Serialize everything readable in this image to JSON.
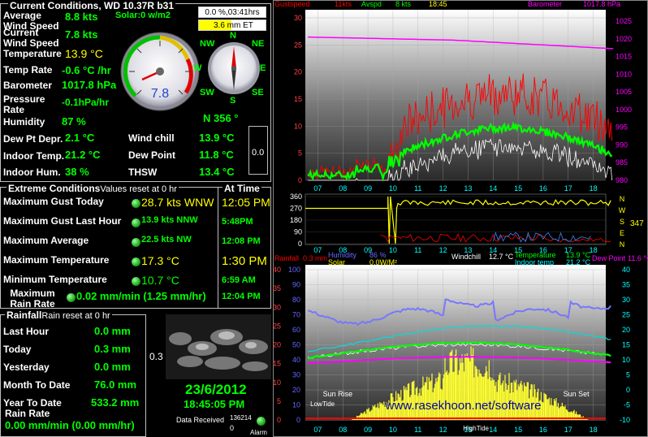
{
  "current": {
    "title": "Current Conditions, WD 10.37R b31",
    "avg_wind_label": "Average Wind Speed",
    "avg_wind_value": "8.8 kts",
    "solar": "Solar:0 w/m2",
    "cur_wind_label": "Current Wind Speed",
    "cur_wind_value": "7.8 kts",
    "temp_label": "Temperature",
    "temp_value": "13.9 °C",
    "temprate_label": "Temp Rate",
    "temprate_value": "-0.6 °C /hr",
    "baro_label": "Barometer",
    "baro_value": "1017.8 hPa",
    "prate_label": "Pressure Rate",
    "prate_value": "-0.1hPa/hr",
    "hum_label": "Humidity",
    "hum_value": "87 %",
    "dir_value": "N  356 °",
    "dew_label": "Dew Pt Depr.",
    "dew_value": "2.1 °C",
    "chill_label": "Wind chill",
    "chill_value": "13.9 °C",
    "itemp_label": "Indoor Temp.",
    "itemp_value": "21.2 °C",
    "dewpt_label": "Dew Point",
    "dewpt_value": "11.8 °C",
    "ihum_label": "Indoor Hum.",
    "ihum_value": "38 %",
    "thsw_label": "THSW",
    "thsw_value": "13.4 °C",
    "box_value": "0.0",
    "rain_pct": "0.0 %,03:41hrs",
    "et": "3.6 mm ET",
    "gauge_speed": "7.8"
  },
  "extremes": {
    "title": "Extreme Conditions",
    "reset": "Values reset at 0 hr",
    "at_time": "At Time",
    "rows": [
      {
        "label": "Maximum Gust Today",
        "value": "28.7 kts WNW",
        "time": "12:05 PM"
      },
      {
        "label": "Maximum Gust Last Hour",
        "value": "13.9 kts NNW",
        "time": "5:48PM"
      },
      {
        "label": "Maximum Average",
        "value": "22.5 kts  NW",
        "time": "12:08 PM"
      },
      {
        "label": "Maximum Temperature",
        "value": "17.3 °C",
        "time": "1:30 PM"
      },
      {
        "label": "Minimum Temperature",
        "value": "10.7 °C",
        "time": "6:59 AM"
      },
      {
        "label": "Maximum Rain Rate",
        "value": "0.02 mm/min (1.25 mm/hr)",
        "time": "12:04 PM"
      }
    ]
  },
  "rainfall": {
    "title": "Rainfall",
    "reset": "Rain reset at 0 hr",
    "rows": [
      {
        "label": "Last Hour",
        "value": "0.0 mm"
      },
      {
        "label": "Today",
        "value": "0.3 mm"
      },
      {
        "label": "Yesterday",
        "value": "0.0 mm"
      },
      {
        "label": "Month To Date",
        "value": "76.0 mm"
      },
      {
        "label": "Year To Date",
        "value": "533.2 mm"
      }
    ],
    "rate_label": "Rain Rate",
    "rate_value": "0.00 mm/min (0.00 mm/hr)",
    "side_value": "0.3"
  },
  "datetime": {
    "date": "23/6/2012",
    "time": "18:45:05 PM",
    "data_received_label": "Data Received",
    "data_received_value": "136214",
    "data_zero": "0",
    "alarm": "Alarm"
  },
  "graph1": {
    "legend": [
      "Gustspeed",
      "11kts",
      "Avspd",
      "8 kts",
      "18:45",
      "Barometer",
      "1017.8 hPa"
    ],
    "left_ticks": [
      "30",
      "25",
      "20",
      "15",
      "10",
      "5",
      "0"
    ],
    "right_ticks": [
      "1025",
      "1020",
      "1015",
      "1010",
      "1005",
      "1000",
      "995",
      "990",
      "985",
      "980"
    ],
    "x_ticks": [
      "07",
      "08",
      "09",
      "10",
      "11",
      "12",
      "13",
      "14",
      "15",
      "16",
      "17",
      "18"
    ]
  },
  "graph2": {
    "left_ticks": [
      "360",
      "270",
      "180",
      "90",
      "0"
    ],
    "right_letters": [
      "N",
      "W",
      "S",
      "E",
      "N"
    ],
    "right_value": "347",
    "x_ticks": [
      "07",
      "08",
      "09",
      "10",
      "11",
      "12",
      "13",
      "14",
      "15",
      "16",
      "17",
      "18"
    ]
  },
  "graph3": {
    "legend_rain": "Rainfall",
    "legend_rain_val": "0.3 mm",
    "legend_humidity": "Humidity",
    "legend_humidity_val": "86 %",
    "legend_solar": "Solar",
    "legend_solar_val": "0.0W/M²",
    "legend_chill": "Windchill",
    "legend_chill_val": "12.7 °C",
    "legend_temp": "Temperature",
    "legend_temp_val": "13.9 °C",
    "legend_itemp": "Indoor temp",
    "legend_itemp_val": "21.2 °C",
    "legend_dew": "Dew Point",
    "legend_dew_val": "11.6 °C",
    "left_ticks": [
      "40",
      "35",
      "30",
      "25",
      "20",
      "15",
      "10",
      "5",
      "0"
    ],
    "left_ticks2": [
      "100",
      "90",
      "80",
      "70",
      "60",
      "50",
      "40",
      "30",
      "20",
      "10",
      "0"
    ],
    "right_ticks": [
      "40",
      "35",
      "30",
      "25",
      "20",
      "15",
      "10",
      "5",
      "0",
      "-5",
      "-10"
    ],
    "x_ticks": [
      "07",
      "08",
      "09",
      "10",
      "11",
      "12",
      "13",
      "14",
      "15",
      "16",
      "17",
      "18"
    ],
    "sunrise": "Sun Rise",
    "sunset": "Sun Set",
    "lowtide": "LowTide",
    "hightide": "HighTide",
    "website": "www.rasekhoon.net/software"
  },
  "compass": {
    "N": "N",
    "NE": "NE",
    "E": "E",
    "SE": "SE",
    "S": "S",
    "SW": "SW",
    "W": "W",
    "NW": "NW"
  },
  "colors": {
    "green": "#00ff00",
    "yellow": "#ffff00",
    "red": "#ff0000",
    "magenta": "#ff00ff",
    "cyan": "#00ffff",
    "blue": "#6666ff"
  }
}
